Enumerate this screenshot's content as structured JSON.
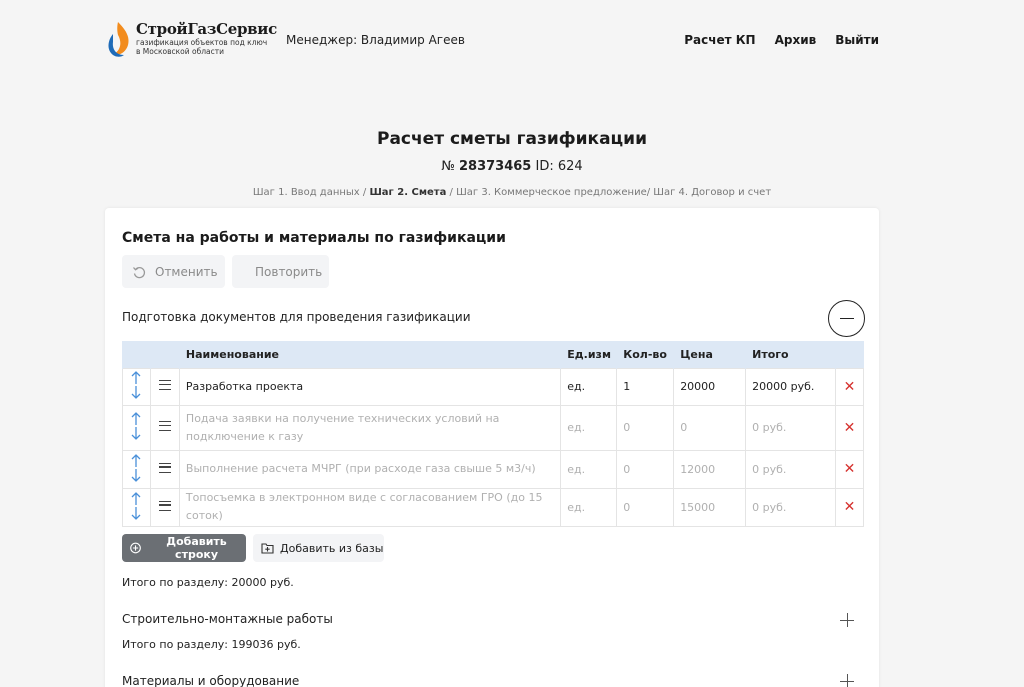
{
  "brand": {
    "name": "СтройГазСервис",
    "tagline_line1": "газификация объектов под ключ",
    "tagline_line2": "в Московской области"
  },
  "manager": "Менеджер: Владимир Агеев",
  "nav": {
    "calc": "Расчет КП",
    "archive": "Архив",
    "logout": "Выйти"
  },
  "page": {
    "title": "Расчет сметы газификации",
    "number_prefix": "№",
    "number": "28373465",
    "id": "ID: 624",
    "step1": "Шаг 1. Ввод данных /",
    "step2": "Шаг 2. Смета",
    "step_rest": "/ Шаг 3. Коммерческое предложение/ Шаг 4. Договор и счет"
  },
  "card": {
    "title": "Смета на работы и материалы по газификации",
    "undo_label": "Отменить",
    "redo_label": "Повторить"
  },
  "section1": {
    "title": "Подготовка документов для проведения газификации",
    "columns": {
      "name": "Наименование",
      "unit": "Ед.изм",
      "qty": "Кол-во",
      "price": "Цена",
      "total": "Итого"
    },
    "rows": [
      {
        "name": "Разработка проекта",
        "unit": "ед.",
        "qty": "1",
        "price": "20000",
        "total": "20000 руб."
      },
      {
        "name": "Подача заявки на получение технических условий на подключение к газу",
        "unit": "ед.",
        "qty": "0",
        "price": "0",
        "total": "0 руб."
      },
      {
        "name": "Выполнение расчета МЧРГ (при расходе газа свыше 5 м3/ч)",
        "unit": "ед.",
        "qty": "0",
        "price": "12000",
        "total": "0 руб."
      },
      {
        "name": "Топосъемка в электронном виде с согласованием ГРО (до 15 соток)",
        "unit": "ед.",
        "qty": "0",
        "price": "15000",
        "total": "0 руб."
      }
    ],
    "add_row_label": "Добавить строку",
    "add_from_base_label": "Добавить из базы",
    "total": "Итого по разделу: 20000 руб."
  },
  "section2": {
    "title": "Строительно-монтажные работы",
    "total": "Итого по разделу: 199036 руб."
  },
  "section3": {
    "title": "Материалы и оборудование"
  },
  "colors": {
    "header_bg": "#dde8f5",
    "arrow": "#4a90d9",
    "delete": "#d6322f",
    "add_btn": "#6b6f74"
  }
}
